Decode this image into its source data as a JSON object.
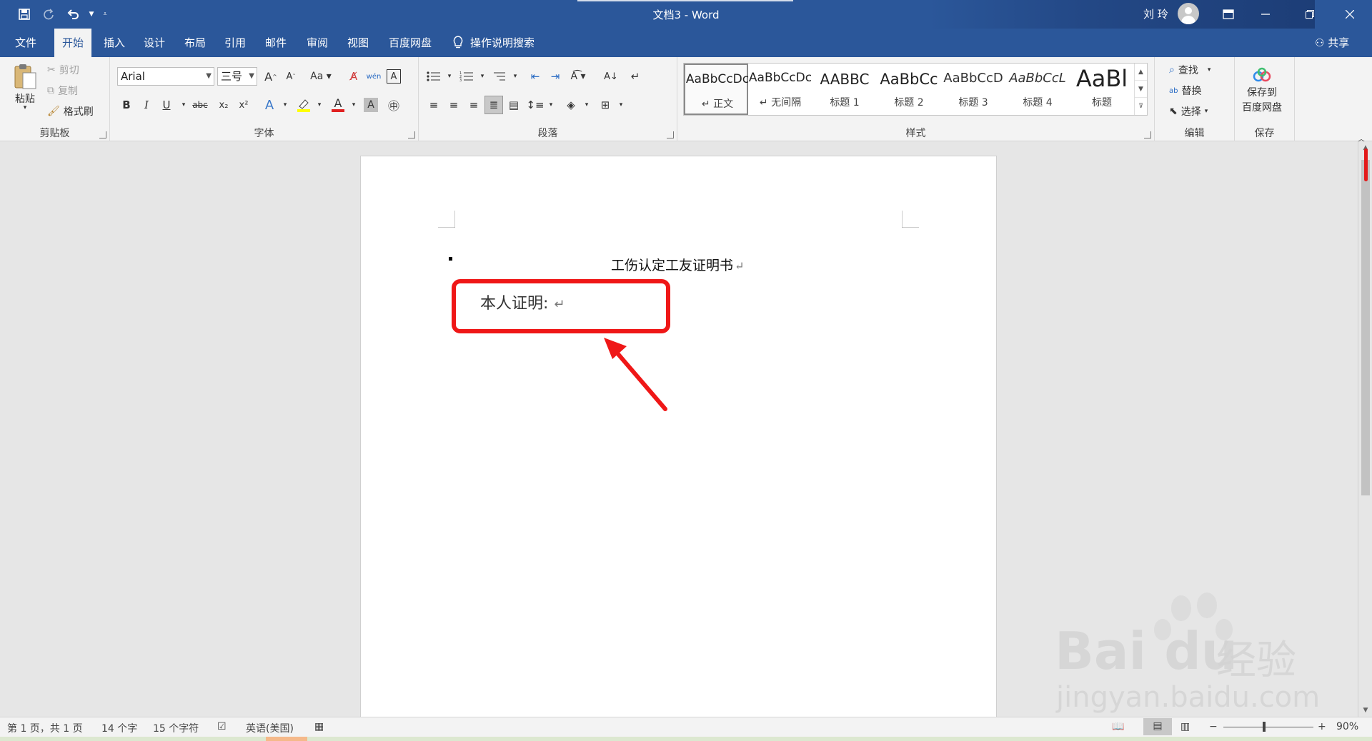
{
  "window": {
    "title": "文档3  -  Word",
    "user": "刘 玲"
  },
  "qat": {
    "save_icon": "save-icon",
    "redo_icon": "redo-icon",
    "undo_icon": "undo-icon"
  },
  "tabs": [
    {
      "label": "文件"
    },
    {
      "label": "开始"
    },
    {
      "label": "插入"
    },
    {
      "label": "设计"
    },
    {
      "label": "布局"
    },
    {
      "label": "引用"
    },
    {
      "label": "邮件"
    },
    {
      "label": "审阅"
    },
    {
      "label": "视图"
    },
    {
      "label": "百度网盘"
    }
  ],
  "tellme": "操作说明搜索",
  "share": "共享",
  "clipboard": {
    "paste": "粘贴",
    "cut": "剪切",
    "copy": "复制",
    "format_painter": "格式刷",
    "group": "剪贴板"
  },
  "font": {
    "name": "Arial",
    "size": "三号",
    "group": "字体",
    "bold": "B",
    "italic": "I",
    "underline": "U",
    "strike": "abc",
    "sub": "x₂",
    "sup": "x²",
    "grow": "A",
    "shrink": "A",
    "case": "Aa",
    "color_letter": "A",
    "highlight_color": "#ffff00",
    "font_color": "#e02020"
  },
  "paragraph": {
    "group": "段落"
  },
  "styles": {
    "group": "样式",
    "items": [
      {
        "preview": "AaBbCcDc",
        "name": "↵ 正文"
      },
      {
        "preview": "AaBbCcDc",
        "name": "↵ 无间隔"
      },
      {
        "preview": "AABBC",
        "name": "标题 1"
      },
      {
        "preview": "AaBbCc",
        "name": "标题 2"
      },
      {
        "preview": "AaBbCcD",
        "name": "标题 3"
      },
      {
        "preview": "AaBbCcL",
        "name": "标题 4"
      },
      {
        "preview": "AaBl",
        "name": "标题"
      }
    ]
  },
  "editing": {
    "find": "查找",
    "replace": "替换",
    "select": "选择",
    "group": "编辑"
  },
  "save_group": {
    "button_line1": "保存到",
    "button_line2": "百度网盘",
    "group": "保存"
  },
  "document": {
    "title": "工伤认定工友证明书",
    "line1": "本人证明:",
    "para_mark": "↵"
  },
  "status": {
    "page": "第 1 页，共 1 页",
    "words": "14 个字",
    "chars": "15 个字符",
    "language": "英语(美国)",
    "zoom": "90%",
    "zoom_level": 0.9
  },
  "watermark": {
    "brand": "Bai du",
    "brand_cn": "经验",
    "url": "jingyan.baidu.com"
  },
  "colors": {
    "accent": "#2b579a",
    "highlight_box": "#ef1717"
  }
}
